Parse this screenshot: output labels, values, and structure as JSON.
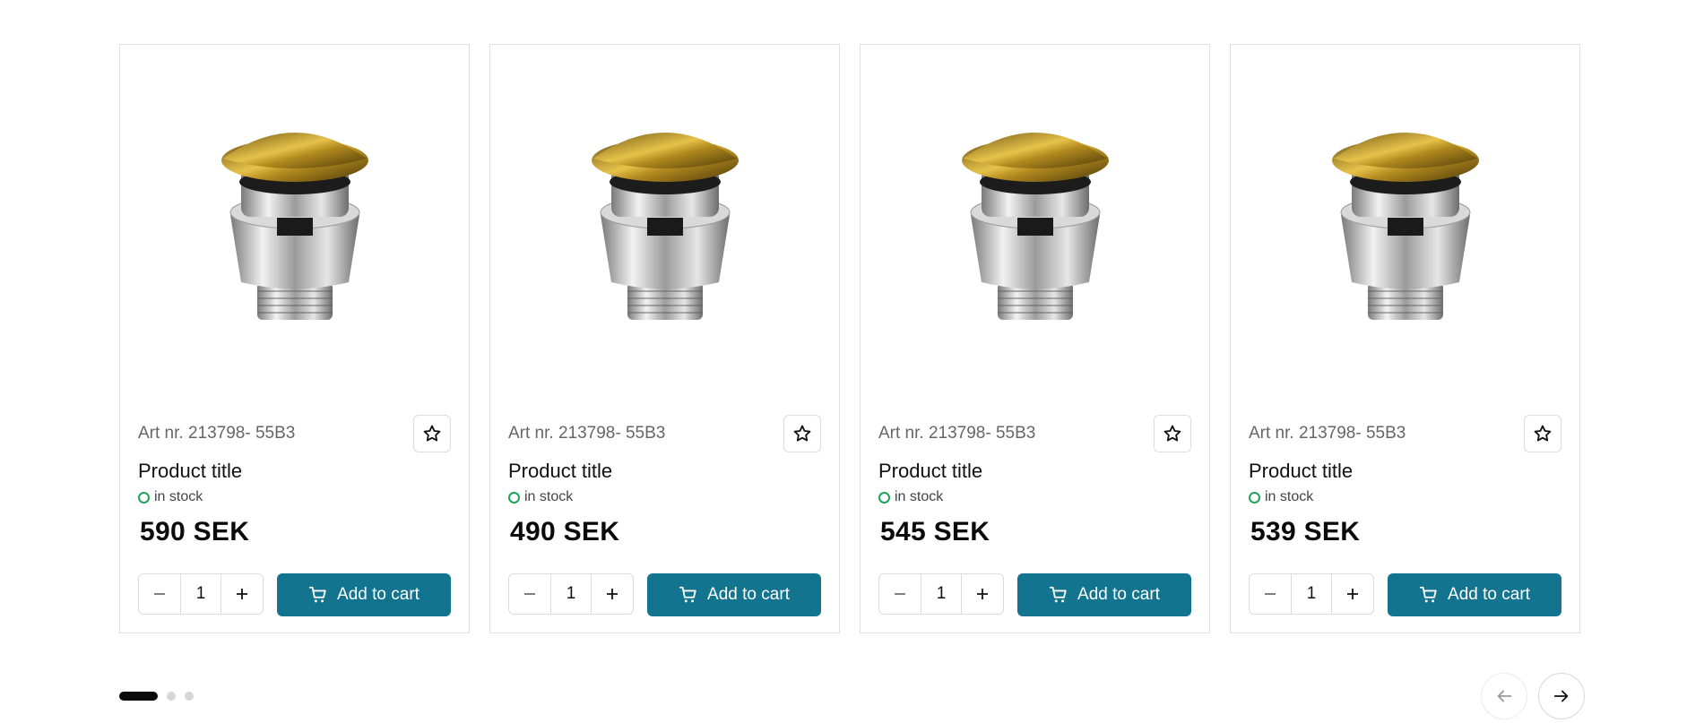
{
  "products": [
    {
      "art_nr": "Art nr. 213798- 55B3",
      "title": "Product title",
      "stock": "in stock",
      "price": "590 SEK",
      "quantity": "1",
      "add_to_cart": "Add to cart"
    },
    {
      "art_nr": "Art nr. 213798- 55B3",
      "title": "Product title",
      "stock": "in stock",
      "price": "490 SEK",
      "quantity": "1",
      "add_to_cart": "Add to cart"
    },
    {
      "art_nr": "Art nr. 213798- 55B3",
      "title": "Product title",
      "stock": "in stock",
      "price": "545 SEK",
      "quantity": "1",
      "add_to_cart": "Add to cart"
    },
    {
      "art_nr": "Art nr. 213798- 55B3",
      "title": "Product title",
      "stock": "in stock",
      "price": "539 SEK",
      "quantity": "1",
      "add_to_cart": "Add to cart"
    }
  ],
  "pagination": {
    "pages": 3,
    "active_index": 0
  },
  "icons": {
    "favorite": "star-outline-icon",
    "decrease": "minus-icon",
    "increase": "plus-icon",
    "cart": "shopping-cart-icon",
    "prev": "arrow-left-icon",
    "next": "arrow-right-icon",
    "stock": "stock-status-ring-icon"
  },
  "colors": {
    "accent": "#12748f",
    "in_stock": "#1fa35a",
    "border": "#e0e0e0",
    "active_dot": "#0b0b0b",
    "inactive_dot": "#d6d6d6"
  }
}
